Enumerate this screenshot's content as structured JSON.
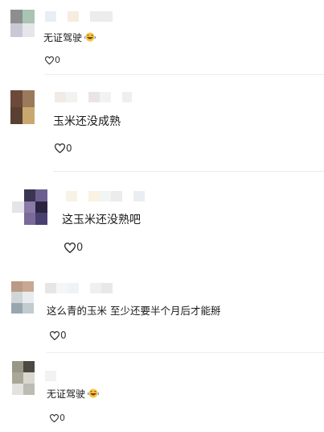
{
  "comments": [
    {
      "text": "无证驾驶",
      "likes": "0",
      "emoji": "laughing-emoji"
    },
    {
      "text": "玉米还没成熟",
      "likes": "0"
    },
    {
      "text": "这玉米还没熟吧",
      "likes": "0"
    },
    {
      "text": "这么青的玉米 至少还要半个月后才能掰",
      "likes": "0"
    },
    {
      "text": "无证驾驶",
      "likes": "0",
      "emoji": "laughing-emoji"
    }
  ]
}
